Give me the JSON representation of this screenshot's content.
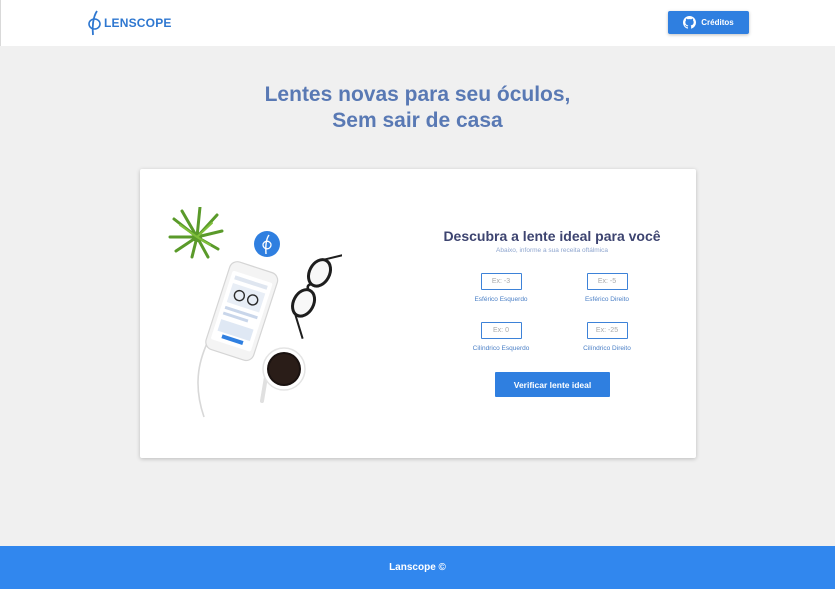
{
  "header": {
    "logo_text": "LENSCOPE",
    "credits_label": "Créditos"
  },
  "hero": {
    "line1": "Lentes novas para seu óculos,",
    "line2": "Sem sair de casa"
  },
  "form": {
    "title": "Descubra a lente ideal para você",
    "subtitle": "Abaixo, informe a sua receita oftálmica",
    "fields": [
      {
        "placeholder": "Ex: -3",
        "label": "Esférico Esquerdo"
      },
      {
        "placeholder": "Ex: -5",
        "label": "Esférico Direito"
      },
      {
        "placeholder": "Ex: 0",
        "label": "Cilíndrico Esquerdo"
      },
      {
        "placeholder": "Ex: -25",
        "label": "Cilíndrico Direito"
      }
    ],
    "submit_label": "Verificar lente ideal"
  },
  "footer": {
    "text": "Lanscope ©"
  },
  "colors": {
    "primary": "#2f7fe0",
    "hero_text": "#5979b4",
    "title_text": "#3d4470",
    "footer_bg": "#3187ee"
  }
}
